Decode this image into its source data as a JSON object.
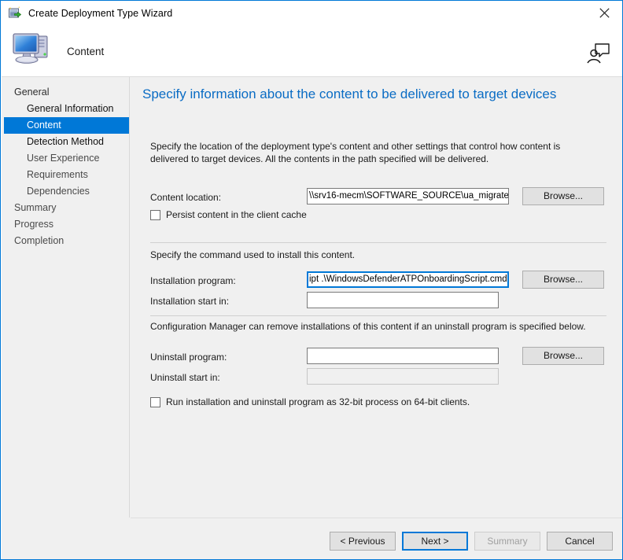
{
  "window": {
    "title": "Create Deployment Type Wizard",
    "title_icon": "deployment-wizard-icon",
    "close_icon": "close-icon"
  },
  "banner": {
    "title": "Content",
    "icon": "computer-icon",
    "help_icon": "presenter-help-icon"
  },
  "sidebar": {
    "items": [
      {
        "label": "General",
        "level": 0,
        "state": "normal"
      },
      {
        "label": "General Information",
        "level": 1,
        "state": "normal"
      },
      {
        "label": "Content",
        "level": 1,
        "state": "selected"
      },
      {
        "label": "Detection Method",
        "level": 1,
        "state": "strong"
      },
      {
        "label": "User Experience",
        "level": 1,
        "state": "dim"
      },
      {
        "label": "Requirements",
        "level": 1,
        "state": "dim"
      },
      {
        "label": "Dependencies",
        "level": 1,
        "state": "dim"
      },
      {
        "label": "Summary",
        "level": 0,
        "state": "dim"
      },
      {
        "label": "Progress",
        "level": 0,
        "state": "dim"
      },
      {
        "label": "Completion",
        "level": 0,
        "state": "dim"
      }
    ]
  },
  "main": {
    "heading": "Specify information about the content to be delivered to target devices",
    "description": "Specify the location of the deployment type's content and other settings that control how content is delivered to target devices. All the contents in the path specified will be delivered.",
    "content_location_label": "Content location:",
    "content_location_value": "\\\\srv16-mecm\\SOFTWARE_SOURCE\\ua_migrate",
    "browse_label_1": "Browse...",
    "persist_checkbox_label": "Persist content in the client cache",
    "install_section_text": "Specify the command used to install this content.",
    "installation_program_label": "Installation program:",
    "installation_program_value": "ipt .\\WindowsDefenderATPOnboardingScript.cmd",
    "browse_label_2": "Browse...",
    "installation_start_in_label": "Installation start in:",
    "installation_start_in_value": "",
    "uninstall_section_text": "Configuration Manager can remove installations of this content if an uninstall program is specified below.",
    "uninstall_program_label": "Uninstall program:",
    "uninstall_program_value": "",
    "browse_label_3": "Browse...",
    "uninstall_start_in_label": "Uninstall start in:",
    "uninstall_start_in_value": "",
    "run32bit_checkbox_label": "Run installation and uninstall program as 32-bit process on 64-bit clients."
  },
  "footer": {
    "previous_label": "< Previous",
    "next_label": "Next >",
    "summary_label": "Summary",
    "cancel_label": "Cancel"
  },
  "colors": {
    "accent": "#0078d7",
    "heading": "#0a6cc4",
    "body_bg": "#f0f0f0"
  }
}
